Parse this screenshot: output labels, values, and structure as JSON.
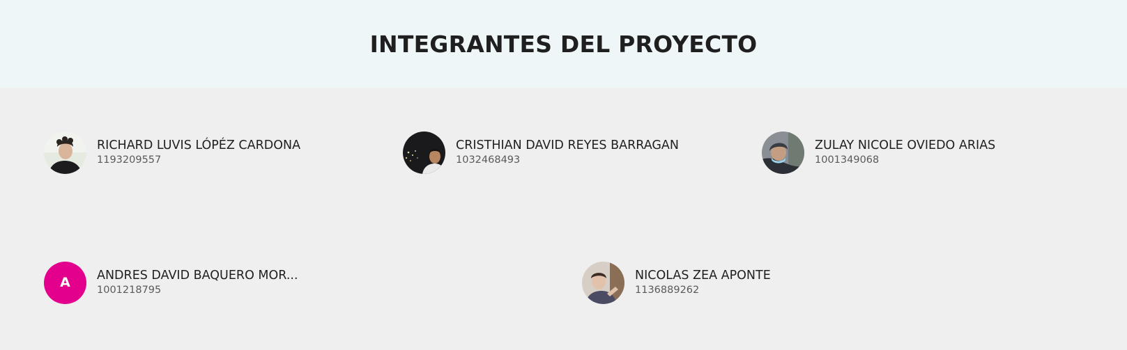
{
  "page": {
    "title": "INTEGRANTES DEL PROYECTO"
  },
  "members": [
    {
      "name": "RICHARD LUVIS LÓPÉZ CARDONA",
      "id": "1193209557",
      "avatar": "photo"
    },
    {
      "name": "CRISTHIAN DAVID REYES BARRAGAN",
      "id": "1032468493",
      "avatar": "photo"
    },
    {
      "name": "ZULAY NICOLE OVIEDO ARIAS",
      "id": "1001349068",
      "avatar": "photo"
    },
    {
      "name": "ANDRES DAVID BAQUERO MOR...",
      "id": "1001218795",
      "avatar": "initial",
      "initial": "A",
      "avatar_color": "#e3008c"
    },
    {
      "name": "NICOLAS ZEA APONTE",
      "id": "1136889262",
      "avatar": "photo"
    }
  ]
}
